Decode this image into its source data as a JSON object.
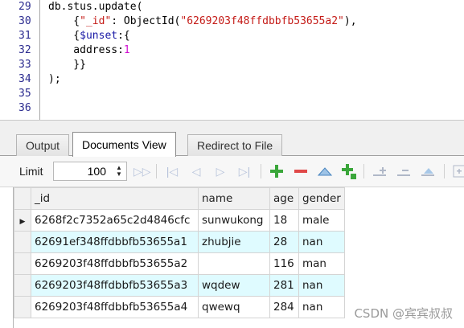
{
  "editor": {
    "line_numbers": [
      "29",
      "30",
      "31",
      "32",
      "33",
      "34",
      "35",
      "36"
    ],
    "lines": [
      [
        {
          "t": "db.stus.update(",
          "c": ""
        }
      ],
      [
        {
          "t": "    {",
          "c": ""
        },
        {
          "t": "\"_id\"",
          "c": "red"
        },
        {
          "t": ": ObjectId(",
          "c": ""
        },
        {
          "t": "\"6269203f48ffdbbfb53655a2\"",
          "c": "red"
        },
        {
          "t": "),",
          "c": ""
        }
      ],
      [
        {
          "t": "    {",
          "c": ""
        },
        {
          "t": "$unset",
          "c": "blue"
        },
        {
          "t": ":{",
          "c": ""
        }
      ],
      [
        {
          "t": "    address:",
          "c": ""
        },
        {
          "t": "1",
          "c": "mag"
        }
      ],
      [
        {
          "t": "    }}",
          "c": ""
        }
      ],
      [
        {
          "t": ");",
          "c": ""
        }
      ],
      [
        {
          "t": "",
          "c": ""
        }
      ],
      [
        {
          "t": "",
          "c": ""
        }
      ]
    ]
  },
  "tabs": [
    "Output",
    "Documents View",
    "Redirect to File"
  ],
  "active_tab": "Documents View",
  "toolbar": {
    "limit_label": "Limit",
    "limit_value": "100",
    "spin_up": "▲",
    "spin_down": "▼",
    "nav_icons": [
      "▷▷",
      "|◁",
      "◁",
      "▷",
      "▷|"
    ]
  },
  "grid": {
    "columns": [
      "_id",
      "name",
      "age",
      "gender"
    ],
    "rows": [
      {
        "id": "6268f2c7352a65c2d4846cfc",
        "name": "sunwukong",
        "age": "18",
        "gender": "male",
        "current": true
      },
      {
        "id": "62691ef348ffdbbfb53655a1",
        "name": "zhubjie",
        "age": "28",
        "gender": "nan",
        "current": false
      },
      {
        "id": "6269203f48ffdbbfb53655a2",
        "name": "",
        "age": "116",
        "gender": "man",
        "current": false
      },
      {
        "id": "6269203f48ffdbbfb53655a3",
        "name": "wqdew",
        "age": "281",
        "gender": "nan",
        "current": false
      },
      {
        "id": "6269203f48ffdbbfb53655a4",
        "name": "qwewq",
        "age": "284",
        "gender": "nan",
        "current": false
      }
    ],
    "current_row_marker": "▶"
  },
  "watermark": "CSDN @宾宾叔叔",
  "colors": {
    "alt_row": "#dffbff",
    "add_icon": "#3aa63a",
    "delete_icon": "#e04848",
    "nav_icon": "#b7c3db"
  }
}
